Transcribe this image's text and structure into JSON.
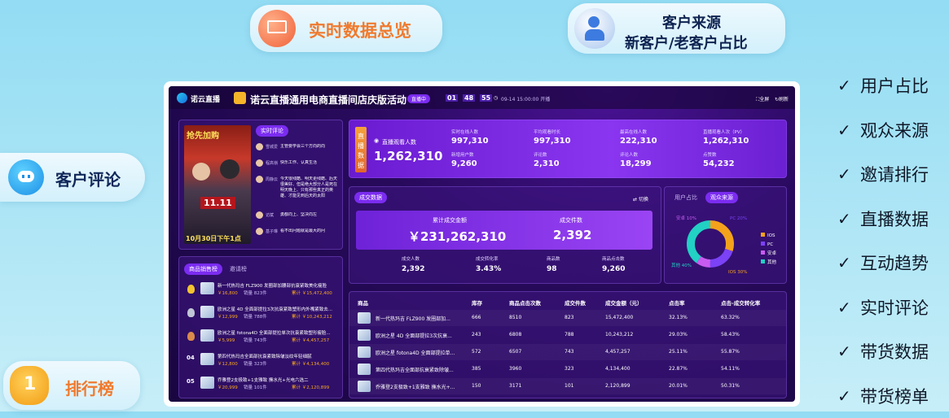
{
  "pills": {
    "realtime_overview": "实时数据总览",
    "customer_source_l1": "客户来源",
    "customer_source_l2": "新客户/老客户占比",
    "customer_comments": "客户评论",
    "ranking": "排行榜",
    "rank_badge": "1"
  },
  "features": [
    "用户占比",
    "观众来源",
    "邀请排行",
    "直播数据",
    "互动趋势",
    "实时评论",
    "带货数据",
    "带货榜单"
  ],
  "check_mark": "✓",
  "header": {
    "logo": "诺云直播",
    "title": "诺云直播通用电商直播间店庆版活动",
    "live_badge": "直播中",
    "countdown": [
      "01",
      "48",
      "55"
    ],
    "date": "09-14 15:00:00 开播",
    "fullscreen": "全屏",
    "refresh": "刷新"
  },
  "live": {
    "banner": "抢先加购",
    "date_text": "10月30日下午1点",
    "sign": "11.11",
    "comments_tab": "实时评论",
    "comments": [
      {
        "name": "雪城爱",
        "text": "主管要学会三个方向的向"
      },
      {
        "name": "程高嶺",
        "text": "快乐工作、认真生活"
      },
      {
        "name": "周静云",
        "text": "今天很残酷、明天更残酷、后天很美好、但是绝大部分人是死在明天晚上、只有那些真正的英雄、才能见到后天的太阳"
      },
      {
        "name": "访斌",
        "text": "勇都向上、坚决向左"
      },
      {
        "name": "基子琳",
        "text": "看不出问题就是最大的问"
      }
    ]
  },
  "ranking": {
    "tab_sales": "商品销售榜",
    "tab_invite": "邀请榜",
    "items": [
      {
        "rank": "",
        "name": "新一代热玛吉 FLZ900 发圈部加腰部抗衰紧致美化瘦脸",
        "price": "￥16,800",
        "sales": "销量 823件",
        "total": "累计 ￥15,472,400"
      },
      {
        "rank": "",
        "name": "欧洲之星 4D 全面部提拉3次抗衰紧致塑形内外嘴紧致去...",
        "price": "￥12,999",
        "sales": "销量 788件",
        "total": "累计 ￥10,243,212"
      },
      {
        "rank": "",
        "name": "欧洲之星 fotona4D 全面部提拉单次抗衰紧致塑形瘦脸...",
        "price": "￥5,999",
        "sales": "销量 743件",
        "total": "累计 ￥4,457,257"
      },
      {
        "rank": "04",
        "name": "第四代热玛吉全面部抗衰紧致除皱淡纹年轻细腻",
        "price": "￥12,800",
        "sales": "销量 323件",
        "total": "累计 ￥4,134,400"
      },
      {
        "rank": "05",
        "name": "乔雅登2支极致+1支雅致 撫水光+光电六选二",
        "price": "￥20,999",
        "sales": "销量 101件",
        "total": "累计 ￥2,120,899"
      }
    ]
  },
  "live_data": {
    "label": "直播数据",
    "main_label": "直播观看人数",
    "main_value": "1,262,310",
    "stats": [
      {
        "label": "实时在线人数",
        "value": "997,310"
      },
      {
        "label": "平均观看时长",
        "value": "997,310"
      },
      {
        "label": "最高在线人数",
        "value": "222,310"
      },
      {
        "label": "直播观看人次（PV）",
        "value": "1,262,310"
      },
      {
        "label": "新增用户数",
        "value": "9,260"
      },
      {
        "label": "评论数",
        "value": "2,310"
      },
      {
        "label": "评论人数",
        "value": "18,299"
      },
      {
        "label": "点赞数",
        "value": "54,232"
      }
    ]
  },
  "deals": {
    "title": "成交数据",
    "switch": "切换",
    "total_label": "累计成交金额",
    "total_value": "￥231,262,310",
    "count_label": "成交件数",
    "count_value": "2,392",
    "sub": [
      {
        "label": "成交人数",
        "value": "2,392"
      },
      {
        "label": "成交转化率",
        "value": "3.43%"
      },
      {
        "label": "商品数",
        "value": "98"
      },
      {
        "label": "商品点击数",
        "value": "9,260"
      }
    ]
  },
  "donut": {
    "tab_users": "用户占比",
    "tab_source": "观众来源",
    "slices": [
      {
        "name": "IOS",
        "value": 30,
        "color": "#f4a21c",
        "label": "IOS 30%"
      },
      {
        "name": "PC",
        "value": 20,
        "color": "#7b42f6",
        "label": "PC 20%"
      },
      {
        "name": "安卓",
        "value": 10,
        "color": "#c85cf0",
        "label": "安卓 10%"
      },
      {
        "name": "其他",
        "value": 40,
        "color": "#22d0c4",
        "label": "其他 40%"
      }
    ]
  },
  "table": {
    "headers": [
      "商品",
      "库存",
      "商品点击次数",
      "成交件数",
      "成交金额（元）",
      "点击率",
      "点击-成交转化率"
    ],
    "rows": [
      [
        "新一代热玛吉 FLZ900 发圈部加...",
        "666",
        "8510",
        "823",
        "15,472,400",
        "32.13%",
        "63.32%"
      ],
      [
        "欧洲之星 4D 全面部提拉3次抗衰...",
        "243",
        "6808",
        "788",
        "10,243,212",
        "29.03%",
        "58.43%"
      ],
      [
        "欧洲之星 fotona4D 全面部提拉单...",
        "572",
        "6507",
        "743",
        "4,457,257",
        "25.11%",
        "55.87%"
      ],
      [
        "第四代热玛吉全面部抗衰紧致除皱...",
        "385",
        "3960",
        "323",
        "4,134,400",
        "22.87%",
        "54.11%"
      ],
      [
        "乔雅登2支极致+1支雅致 撫水光+...",
        "150",
        "3171",
        "101",
        "2,120,899",
        "20.01%",
        "50.31%"
      ]
    ]
  }
}
